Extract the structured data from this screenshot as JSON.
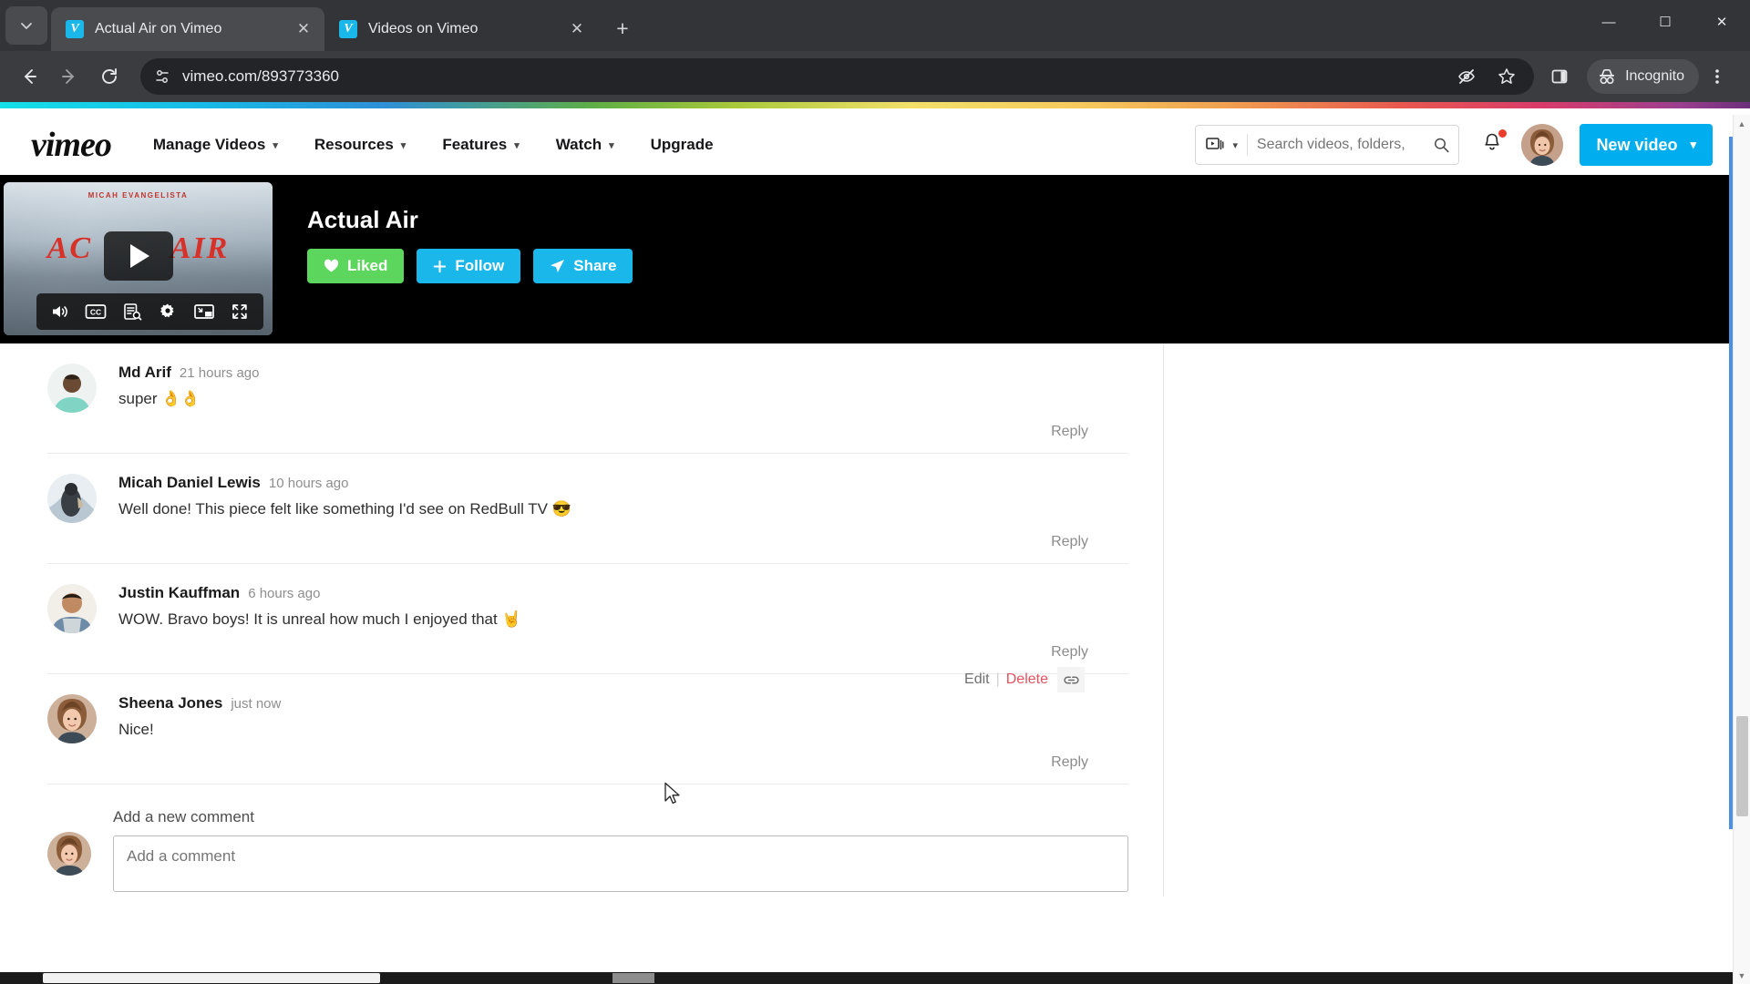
{
  "browser": {
    "tabs": [
      {
        "title": "Actual Air on Vimeo",
        "favicon": "vimeo-icon",
        "active": true
      },
      {
        "title": "Videos on Vimeo",
        "favicon": "vimeo-icon",
        "active": false
      }
    ],
    "new_tab_label": "+",
    "tab_search_icon": "chevron-down-icon",
    "window_controls": {
      "minimize": "—",
      "maximize": "❐",
      "close": "✕"
    },
    "nav": {
      "back": "←",
      "forward": "→",
      "reload": "↻"
    },
    "url": "vimeo.com/893773360",
    "site_info_icon": "page-settings-icon",
    "omnibox_icons": [
      "tracking-protection-icon",
      "bookmark-star-icon",
      "side-panel-icon"
    ],
    "profile_label": "Incognito",
    "menu_icon": "three-dot-menu-icon"
  },
  "site": {
    "logo": "vimeo",
    "nav": [
      {
        "label": "Manage Videos",
        "has_caret": true
      },
      {
        "label": "Resources",
        "has_caret": true
      },
      {
        "label": "Features",
        "has_caret": true
      },
      {
        "label": "Watch",
        "has_caret": true
      },
      {
        "label": "Upgrade",
        "has_caret": false
      }
    ],
    "search": {
      "placeholder": "Search videos, folders,",
      "kind_icon": "video-library-icon",
      "submit_icon": "search-icon"
    },
    "notifications": {
      "icon": "bell-icon",
      "has_unread": true
    },
    "avatar_alt": "user-avatar",
    "new_video_button": {
      "label": "New video",
      "caret": "⌄"
    }
  },
  "video": {
    "thumbnail": {
      "credit": "MICAH EVANGELISTA",
      "title_left": "AC",
      "title_right": "AIR"
    },
    "play_label": "play-button",
    "controls": [
      {
        "name": "volume-icon"
      },
      {
        "name": "captions-icon"
      },
      {
        "name": "transcript-icon"
      },
      {
        "name": "settings-gear-icon"
      },
      {
        "name": "picture-in-picture-icon"
      },
      {
        "name": "fullscreen-icon"
      }
    ],
    "title": "Actual Air",
    "buttons": [
      {
        "label": "Liked",
        "icon": "heart-icon",
        "color": "#5cd65c"
      },
      {
        "label": "Follow",
        "icon": "plus-icon",
        "color": "#1ab7ea"
      },
      {
        "label": "Share",
        "icon": "send-icon",
        "color": "#1ab7ea"
      }
    ]
  },
  "comments": {
    "reply_label": "Reply",
    "items": [
      {
        "author": "Md Arif",
        "time": "21 hours ago",
        "text": "super 👌👌",
        "own": false
      },
      {
        "author": "Micah Daniel Lewis",
        "time": "10 hours ago",
        "text": "Well done! This piece felt like something I'd see on RedBull TV 😎",
        "own": false
      },
      {
        "author": "Justin Kauffman",
        "time": "6 hours ago",
        "text": "WOW. Bravo boys! It is unreal how much I enjoyed that 🤘",
        "own": false
      },
      {
        "author": "Sheena Jones",
        "time": "just now",
        "text": "Nice!",
        "own": true
      }
    ],
    "own_actions": {
      "edit": "Edit",
      "separator": "|",
      "delete": "Delete",
      "link_icon": "link-icon"
    }
  },
  "new_comment": {
    "label": "Add a new comment",
    "placeholder": "Add a comment",
    "value": ""
  },
  "colors": {
    "vimeo_blue": "#00adef",
    "liked_green": "#5cd65c",
    "delete_red": "#e4525f",
    "notification_red": "#ea3c2d",
    "focus_blue": "#4a90e2"
  }
}
